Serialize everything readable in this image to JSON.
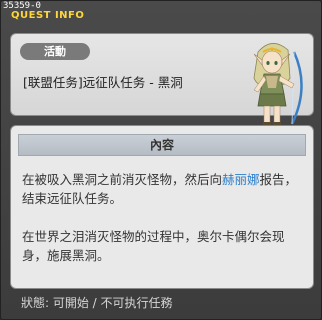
{
  "window": {
    "quest_id": "35359-0",
    "title": "QUEST INFO"
  },
  "header": {
    "badge": "活動",
    "quest_name": "[联盟任务]远征队任务 - 黑洞"
  },
  "content": {
    "heading": "內容",
    "p1_before": "在被吸入黑洞之前消灭怪物，然后向",
    "p1_npc": "赫丽娜",
    "p1_after": "报告，结束远征队任务。",
    "p2": "在世界之泪消灭怪物的过程中，奥尔卡偶尔会现身，施展黑洞。"
  },
  "status": {
    "text": "狀態: 可開始 / 不可执行任務"
  },
  "colors": {
    "title": "#ffd63a",
    "npc_link": "#2a7ecb"
  }
}
